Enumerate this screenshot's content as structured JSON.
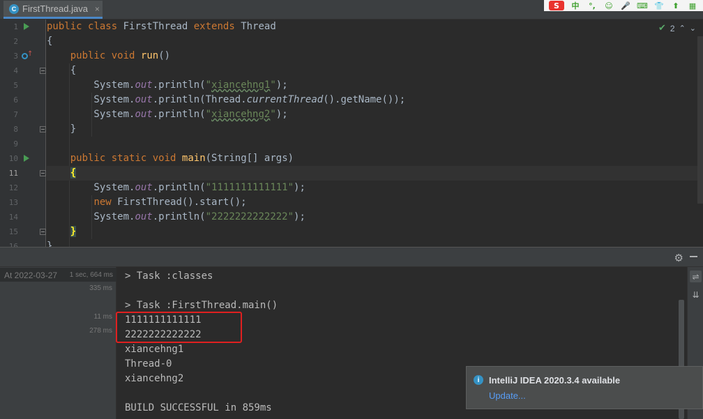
{
  "tab": {
    "icon": "java-class-icon",
    "icon_glyph": "C",
    "label": "FirstThread.java",
    "close": "×"
  },
  "ime": {
    "items": [
      "S",
      "中",
      "°,",
      "☺",
      "🎤",
      "⌨",
      "👕",
      "⬆",
      "▦"
    ]
  },
  "editor": {
    "line_numbers": [
      "1",
      "2",
      "3",
      "4",
      "5",
      "6",
      "7",
      "8",
      "9",
      "10",
      "11",
      "12",
      "13",
      "14",
      "15",
      "16"
    ],
    "current_line": 11,
    "inspection": {
      "count": "2",
      "up": "⌃",
      "down": "⌄"
    },
    "lines": [
      [
        [
          "kw",
          "public "
        ],
        [
          "kw",
          "class "
        ],
        [
          "",
          "FirstThread "
        ],
        [
          "kw",
          "extends "
        ],
        [
          "",
          "Thread"
        ]
      ],
      [
        [
          "",
          "{"
        ]
      ],
      [
        [
          "",
          "    "
        ],
        [
          "kw",
          "public "
        ],
        [
          "kw",
          "void "
        ],
        [
          "fn",
          "run"
        ],
        [
          "",
          "()"
        ]
      ],
      [
        [
          "",
          "    {"
        ]
      ],
      [
        [
          "",
          "        System."
        ],
        [
          "fld",
          "out"
        ],
        [
          "",
          "."
        ],
        [
          "",
          "println("
        ],
        [
          "str",
          "\""
        ],
        [
          "str ul",
          "xiancehng1"
        ],
        [
          "str",
          "\""
        ],
        [
          "",
          ");"
        ]
      ],
      [
        [
          "",
          "        System."
        ],
        [
          "fld",
          "out"
        ],
        [
          "",
          "."
        ],
        [
          "",
          "println(Thread."
        ],
        [
          "ital",
          "currentThread"
        ],
        [
          "",
          "().getName());"
        ]
      ],
      [
        [
          "",
          "        System."
        ],
        [
          "fld",
          "out"
        ],
        [
          "",
          "."
        ],
        [
          "",
          "println("
        ],
        [
          "str",
          "\""
        ],
        [
          "str ul",
          "xiancehng2"
        ],
        [
          "str",
          "\""
        ],
        [
          "",
          ");"
        ]
      ],
      [
        [
          "",
          "    }"
        ]
      ],
      [
        [
          "",
          ""
        ]
      ],
      [
        [
          "",
          "    "
        ],
        [
          "kw",
          "public "
        ],
        [
          "kw",
          "static "
        ],
        [
          "kw",
          "void "
        ],
        [
          "fn",
          "main"
        ],
        [
          "",
          "(String[] args)"
        ]
      ],
      [
        [
          "",
          "    "
        ],
        [
          "brace-match",
          "{"
        ]
      ],
      [
        [
          "",
          "        System."
        ],
        [
          "fld",
          "out"
        ],
        [
          "",
          "."
        ],
        [
          "",
          "println("
        ],
        [
          "str",
          "\"1111111111111\""
        ],
        [
          "",
          ");"
        ]
      ],
      [
        [
          "",
          "        "
        ],
        [
          "kw",
          "new "
        ],
        [
          "",
          "FirstThread().start();"
        ]
      ],
      [
        [
          "",
          "        System."
        ],
        [
          "fld",
          "out"
        ],
        [
          "",
          "."
        ],
        [
          "",
          "println("
        ],
        [
          "str",
          "\"2222222222222\""
        ],
        [
          "",
          ");"
        ]
      ],
      [
        [
          "",
          "    "
        ],
        [
          "brace-match",
          "}"
        ]
      ],
      [
        [
          "",
          "}"
        ]
      ]
    ]
  },
  "run_tree": {
    "row_label": "At 2022-03-27",
    "row_time": "1 sec, 664 ms",
    "times": [
      "335 ms",
      "11 ms",
      "278 ms"
    ]
  },
  "console": {
    "lines": [
      "> Task :classes",
      "",
      "> Task :FirstThread.main()",
      "1111111111111",
      "2222222222222",
      "xiancehng1",
      "Thread-0",
      "xiancehng2",
      "",
      "BUILD SUCCESSFUL in 859ms"
    ]
  },
  "notification": {
    "title": "IntelliJ IDEA 2020.3.4 available",
    "link": "Update..."
  },
  "colors": {
    "accent": "#4a88c7",
    "highlight_box": "#e02020",
    "link": "#589df6"
  }
}
